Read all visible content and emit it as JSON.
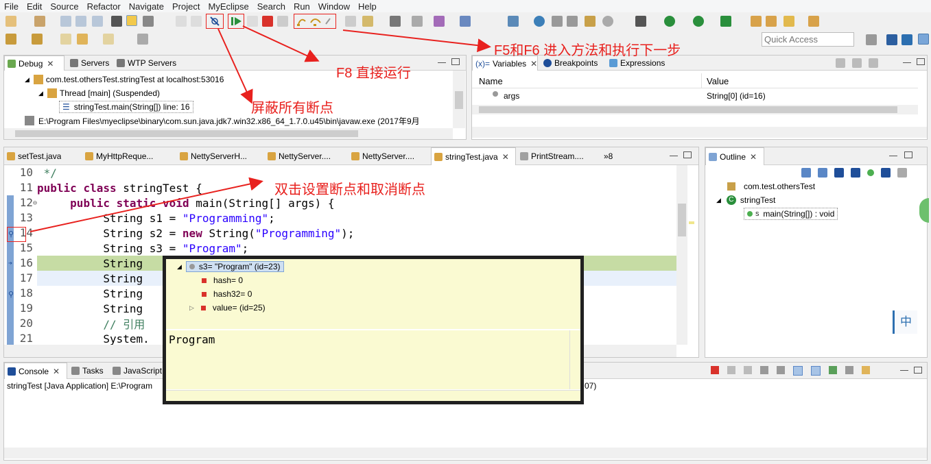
{
  "menu": [
    "File",
    "Edit",
    "Source",
    "Refactor",
    "Navigate",
    "Project",
    "MyEclipse",
    "Search",
    "Run",
    "Window",
    "Help"
  ],
  "quick_access": {
    "placeholder": "Quick Access"
  },
  "debug_panel": {
    "tabs": [
      {
        "label": "Debug",
        "active": true
      },
      {
        "label": "Servers"
      },
      {
        "label": "WTP Servers"
      }
    ],
    "rows": [
      {
        "text": "com.test.othersTest.stringTest at localhost:53016"
      },
      {
        "text": "Thread [main] (Suspended)"
      },
      {
        "text": "stringTest.main(String[]) line: 16"
      },
      {
        "text": "E:\\Program Files\\myeclipse\\binary\\com.sun.java.jdk7.win32.x86_64_1.7.0.u45\\bin\\javaw.exe (2017年9月"
      }
    ]
  },
  "variables_panel": {
    "tabs": [
      {
        "label": "Variables",
        "active": true
      },
      {
        "label": "Breakpoints"
      },
      {
        "label": "Expressions"
      }
    ],
    "columns": [
      "Name",
      "Value"
    ],
    "rows": [
      {
        "name": "args",
        "value": "String[0]  (id=16)"
      }
    ]
  },
  "editor": {
    "tabs": [
      "setTest.java",
      "MyHttpReque...",
      "NettyServerH...",
      "NettyServer....",
      "NettyServer....",
      "stringTest.java",
      "PrintStream....",
      "»8"
    ],
    "active_tab": "stringTest.java",
    "lines": [
      {
        "num": "10",
        "parts": [
          {
            "t": " */",
            "c": "cmt"
          }
        ]
      },
      {
        "num": "11",
        "parts": [
          {
            "t": "public ",
            "c": "kw"
          },
          {
            "t": "class ",
            "c": "kw"
          },
          {
            "t": "stringTest {",
            "c": ""
          }
        ]
      },
      {
        "num": "12",
        "parts": [
          {
            "t": "     ",
            "c": ""
          },
          {
            "t": "public ",
            "c": "kw"
          },
          {
            "t": "static ",
            "c": "kw"
          },
          {
            "t": "void ",
            "c": "kw"
          },
          {
            "t": "main(String[] args) {",
            "c": ""
          }
        ]
      },
      {
        "num": "13",
        "parts": [
          {
            "t": "          String s1 = ",
            "c": ""
          },
          {
            "t": "\"Programming\"",
            "c": "str"
          },
          {
            "t": ";",
            "c": ""
          }
        ]
      },
      {
        "num": "14",
        "parts": [
          {
            "t": "          String s2 = ",
            "c": ""
          },
          {
            "t": "new ",
            "c": "kw"
          },
          {
            "t": "String(",
            "c": ""
          },
          {
            "t": "\"Programming\"",
            "c": "str"
          },
          {
            "t": ");",
            "c": ""
          }
        ]
      },
      {
        "num": "15",
        "parts": [
          {
            "t": "          String s3 = ",
            "c": ""
          },
          {
            "t": "\"Program\"",
            "c": "str"
          },
          {
            "t": ";",
            "c": ""
          }
        ]
      },
      {
        "num": "16",
        "parts": [
          {
            "t": "          String",
            "c": ""
          }
        ]
      },
      {
        "num": "17",
        "parts": [
          {
            "t": "          String",
            "c": ""
          }
        ]
      },
      {
        "num": "18",
        "parts": [
          {
            "t": "          String",
            "c": ""
          }
        ]
      },
      {
        "num": "19",
        "parts": [
          {
            "t": "          String",
            "c": ""
          }
        ]
      },
      {
        "num": "20",
        "parts": [
          {
            "t": "          // 引用",
            "c": "cmt"
          }
        ]
      },
      {
        "num": "21",
        "parts": [
          {
            "t": "          System.",
            "c": ""
          }
        ]
      }
    ]
  },
  "hover_popup": {
    "root": "s3= \"Program\" (id=23)",
    "children": [
      {
        "text": "hash= 0"
      },
      {
        "text": "hash32= 0"
      },
      {
        "text": "value= (id=25)"
      }
    ],
    "detail": "Program"
  },
  "outline_panel": {
    "tab": "Outline",
    "items": [
      {
        "text": "com.test.othersTest"
      },
      {
        "text": "stringTest"
      },
      {
        "text": "main(String[]) : void"
      }
    ],
    "ime": "中"
  },
  "console_panel": {
    "tabs": [
      {
        "label": "Console",
        "active": true
      },
      {
        "label": "Tasks"
      },
      {
        "label": "JavaScript"
      }
    ],
    "header": "stringTest [Java Application] E:\\Program",
    "header_tail": "07)"
  },
  "annotations": [
    {
      "text": "F5和F6 进入方法和执行下一步"
    },
    {
      "text": "F8 直接运行"
    },
    {
      "text": "屏蔽所有断点"
    },
    {
      "text": "双击设置断点和取消断点"
    }
  ],
  "colors": {
    "accent_red": "#e8211e",
    "current_line": "#c6dca4",
    "hover_bg": "#fafad2",
    "blue_sel": "#dbe8f7"
  }
}
